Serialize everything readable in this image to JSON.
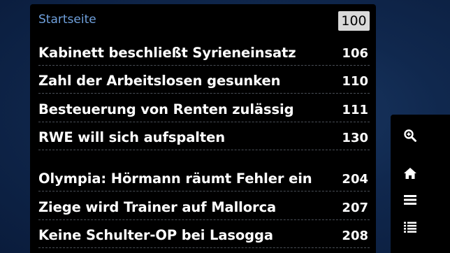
{
  "header": {
    "title": "Startseite",
    "page_number": "100"
  },
  "items": [
    {
      "title": "Kabinett beschließt Syrieneinsatz",
      "page": "106"
    },
    {
      "title": "Zahl der Arbeitslosen gesunken",
      "page": "110"
    },
    {
      "title": "Besteuerung von Renten zulässig",
      "page": "111"
    },
    {
      "title": "RWE will sich aufspalten",
      "page": "130"
    },
    {
      "title": "Olympia: Hörmann räumt Fehler ein",
      "page": "204"
    },
    {
      "title": "Ziege wird Trainer auf Mallorca",
      "page": "207"
    },
    {
      "title": "Keine Schulter-OP bei Lasogga",
      "page": "208"
    }
  ],
  "sidebar": {
    "buttons": [
      "zoom-in-icon",
      "home-icon",
      "menu-icon",
      "list-icon"
    ]
  },
  "colors": {
    "background": "#0f2a52",
    "panel": "#000000",
    "header_title": "#6fa0dc",
    "badge_bg": "#d9d9d9",
    "text": "#ffffff",
    "divider": "#4a4f57"
  }
}
